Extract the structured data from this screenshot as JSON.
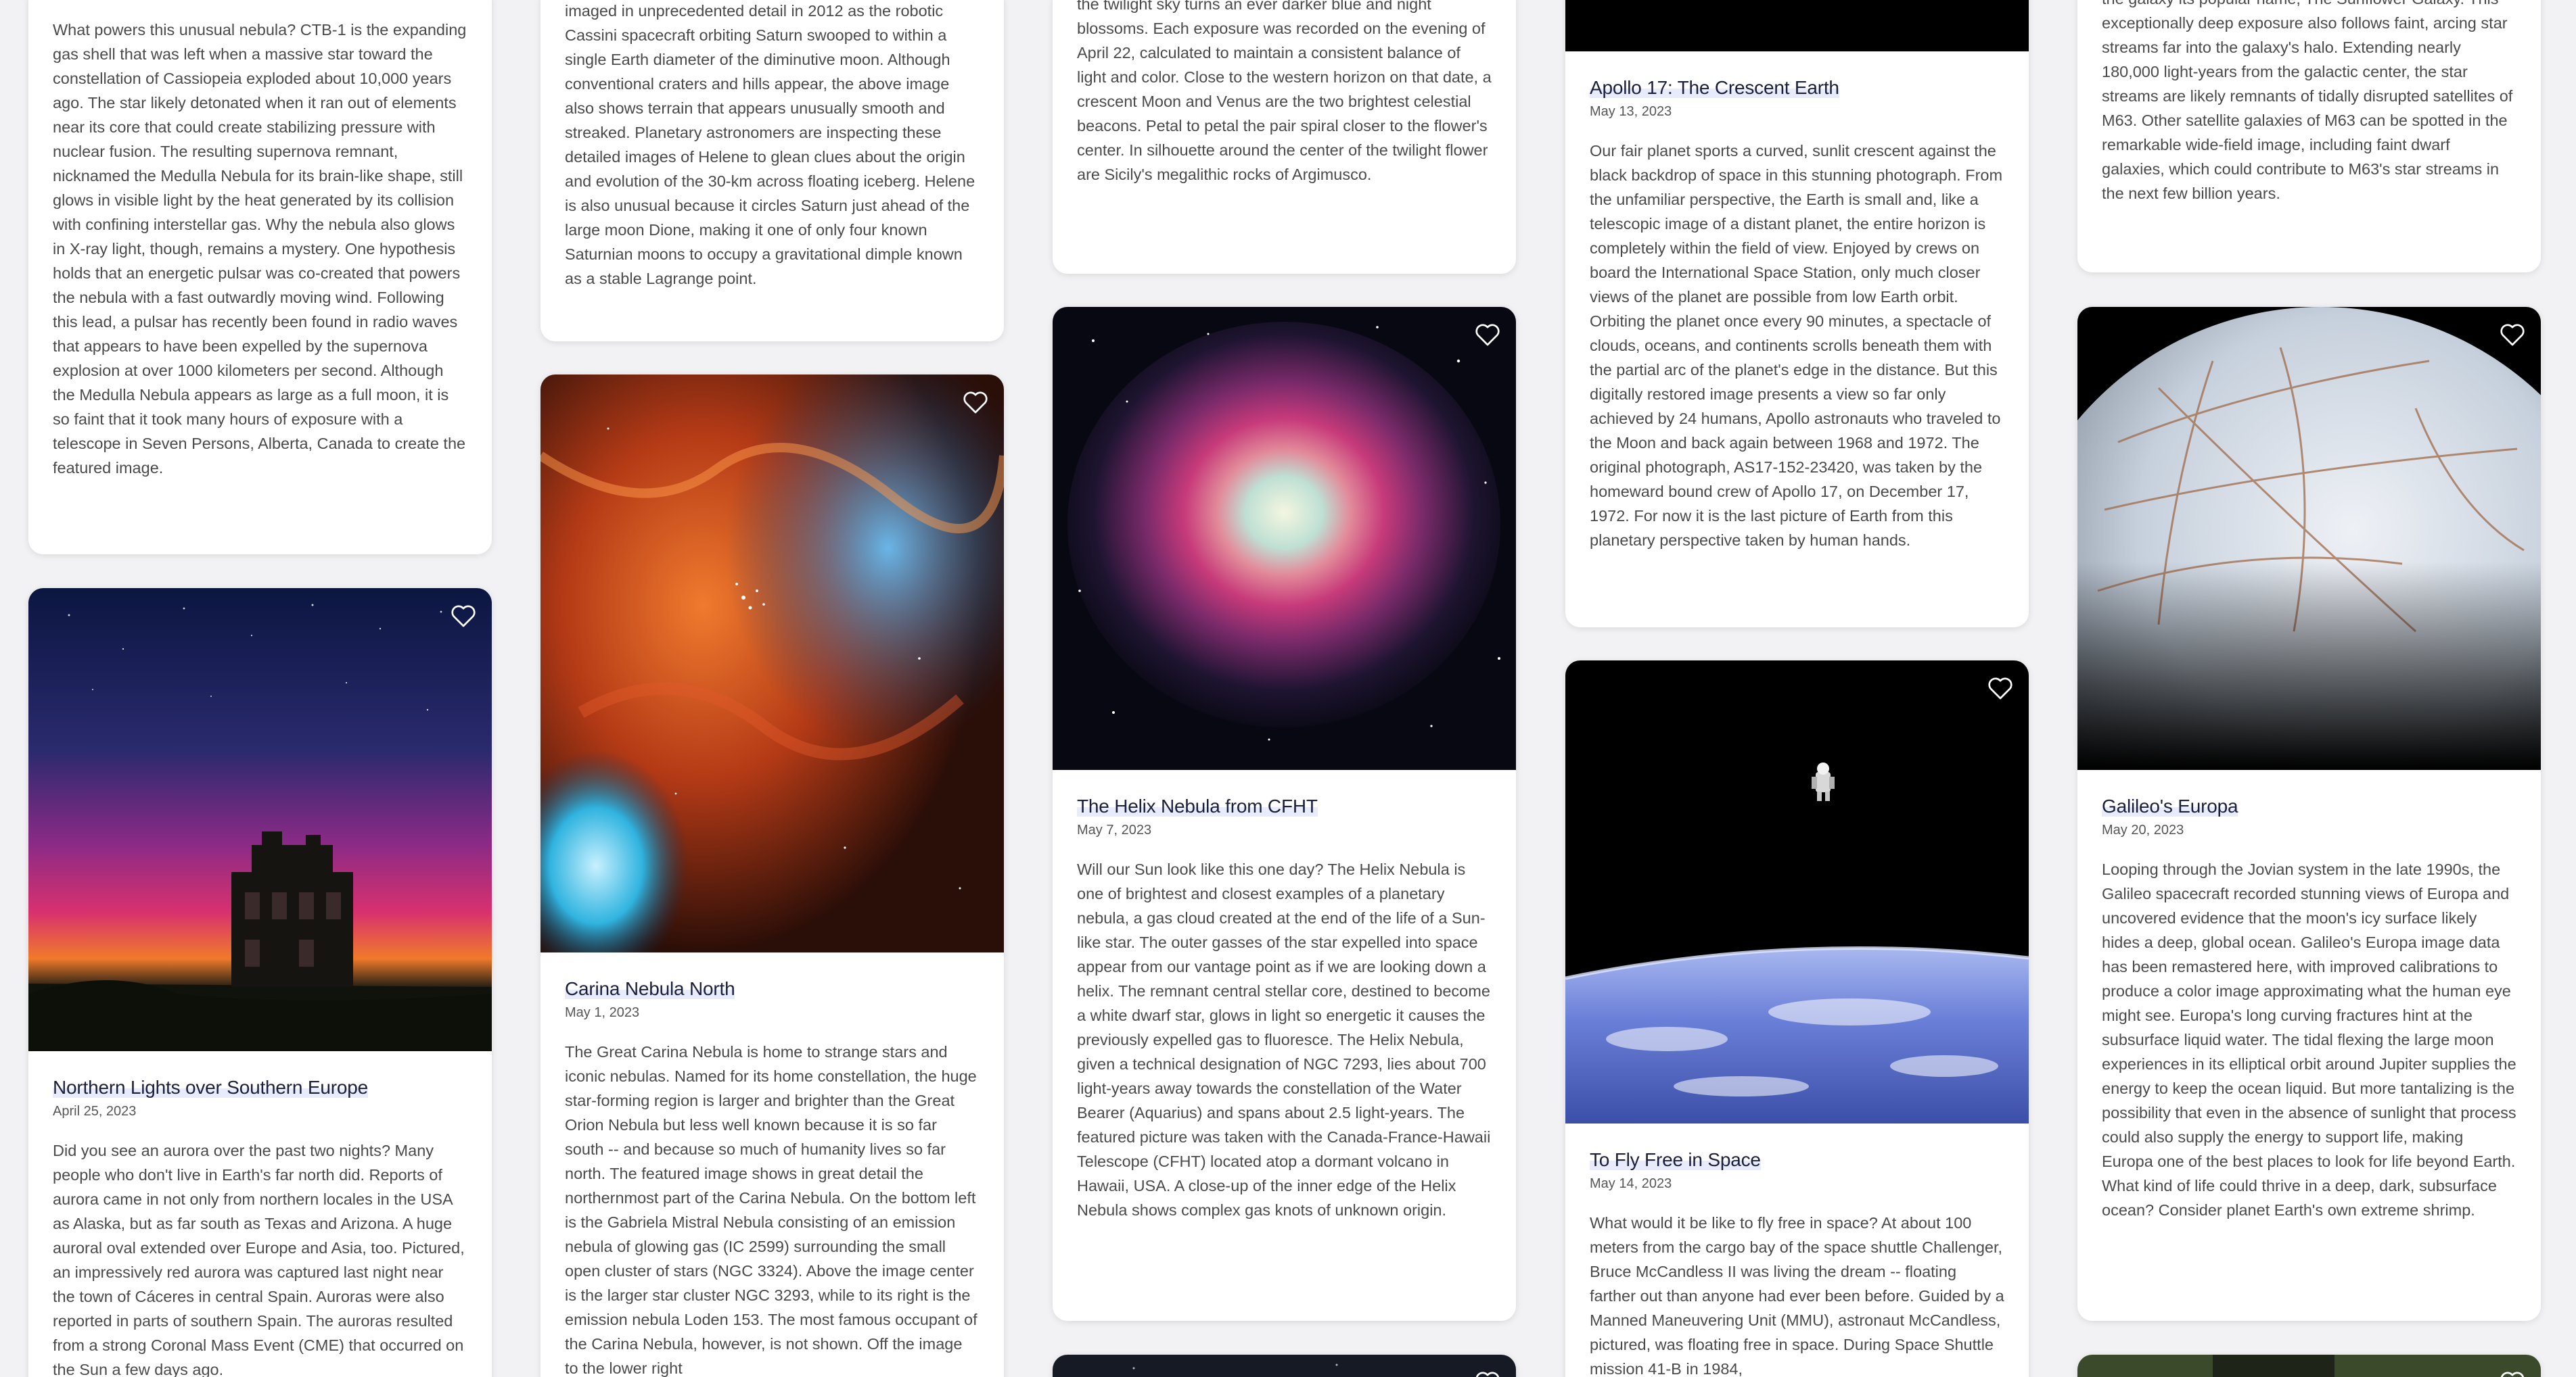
{
  "cards": {
    "ctb1": {
      "text": "What powers this unusual nebula? CTB-1 is the expanding gas shell that was left when a massive star toward the constellation of Cassiopeia exploded about 10,000 years ago. The star likely detonated when it ran out of elements near its core that could create stabilizing pressure with nuclear fusion. The resulting supernova remnant, nicknamed the Medulla Nebula for its brain-like shape, still glows in visible light by the heat generated by its collision with confining interstellar gas. Why the nebula also glows in X-ray light, though, remains a mystery. One hypothesis holds that an energetic pulsar was co-created that powers the nebula with a fast outwardly moving wind. Following this lead, a pulsar has recently been found in radio waves that appears to have been expelled by the supernova explosion at over 1000 kilometers per second. Although the Medulla Nebula appears as large as a full moon, it is so faint that it took many hours of exposure with a telescope in Seven Persons, Alberta, Canada to create the featured image."
    },
    "helene": {
      "text": "imaged in unprecedented detail in 2012 as the robotic Cassini spacecraft orbiting Saturn swooped to within a single Earth diameter of the diminutive moon. Although conventional craters and hills appear, the above image also shows terrain that appears unusually smooth and streaked. Planetary astronomers are inspecting these detailed images of Helene to glean clues about the origin and evolution of the 30-km across floating iceberg. Helene is also unusual because it circles Saturn just ahead of the large moon Dione, making it one of only four known Saturnian moons to occupy a gravitational dimple known as a stable Lagrange point."
    },
    "flower": {
      "text": "the twilight sky turns an ever darker blue and night blossoms. Each exposure was recorded on the evening of April 22, calculated to maintain a consistent balance of light and color. Close to the western horizon on that date, a crescent Moon and Venus are the two brightest celestial beacons. Petal to petal the pair spiral closer to the flower's center. In silhouette around the center of the twilight flower are Sicily's megalithic rocks of Argimusco."
    },
    "apollo": {
      "title": "Apollo 17: The Crescent Earth",
      "date": "May 13, 2023",
      "text": "Our fair planet sports a curved, sunlit crescent against the black backdrop of space in this stunning photograph. From the unfamiliar perspective, the Earth is small and, like a telescopic image of a distant planet, the entire horizon is completely within the field of view. Enjoyed by crews on board the International Space Station, only much closer views of the planet are possible from low Earth orbit. Orbiting the planet once every 90 minutes, a spectacle of clouds, oceans, and continents scrolls beneath them with the partial arc of the planet's edge in the distance. But this digitally restored image presents a view so far only achieved by 24 humans, Apollo astronauts who traveled to the Moon and back again between 1968 and 1972. The original photograph, AS17-152-23420, was taken by the homeward bound crew of Apollo 17, on December 17, 1972. For now it is the last picture of Earth from this planetary perspective taken by human hands."
    },
    "sunflower": {
      "text": "the galaxy its popular name, The Sunflower Galaxy. This exceptionally deep exposure also follows faint, arcing star streams far into the galaxy's halo. Extending nearly 180,000 light-years from the galactic center, the star streams are likely remnants of tidally disrupted satellites of M63. Other satellite galaxies of M63 can be spotted in the remarkable wide-field image, including faint dwarf galaxies, which could contribute to M63's star streams in the next few billion years."
    },
    "aurora": {
      "title": "Northern Lights over Southern Europe",
      "date": "April 25, 2023",
      "text": "Did you see an aurora over the past two nights? Many people who don't live in Earth's far north did. Reports of aurora came in not only from northern locales in the USA as Alaska, but as far south as Texas and Arizona. A huge auroral oval extended over Europe and Asia, too. Pictured, an impressively red aurora was captured last night near the town of Cáceres in central Spain. Auroras were also reported in parts of southern Spain. The auroras resulted from a strong Coronal Mass Event (CME) that occurred on the Sun a few days ago."
    },
    "carina": {
      "title": "Carina Nebula North",
      "date": "May 1, 2023",
      "text": "The Great Carina Nebula is home to strange stars and iconic nebulas. Named for its home constellation, the huge star-forming region is larger and brighter than the Great Orion Nebula but less well known because it is so far south -- and because so much of humanity lives so far north. The featured image shows in great detail the northernmost part of the Carina Nebula. On the bottom left is the Gabriela Mistral Nebula consisting of an emission nebula of glowing gas (IC 2599) surrounding the small open cluster of stars (NGC 3324). Above the image center is the larger star cluster NGC 3293, while to its right is the emission nebula Loden 153. The most famous occupant of the Carina Nebula, however, is not shown. Off the image to the lower right"
    },
    "helix": {
      "title": "The Helix Nebula from CFHT",
      "date": "May 7, 2023",
      "text": "Will our Sun look like this one day? The Helix Nebula is one of brightest and closest examples of a planetary nebula, a gas cloud created at the end of the life of a Sun-like star. The outer gasses of the star expelled into space appear from our vantage point as if we are looking down a helix. The remnant central stellar core, destined to become a white dwarf star, glows in light so energetic it causes the previously expelled gas to fluoresce. The Helix Nebula, given a technical designation of NGC 7293, lies about 700 light-years away towards the constellation of the Water Bearer (Aquarius) and spans about 2.5 light-years. The featured picture was taken with the Canada-France-Hawaii Telescope (CFHT) located atop a dormant volcano in Hawaii, USA. A close-up of the inner edge of the Helix Nebula shows complex gas knots of unknown origin."
    },
    "flyfree": {
      "title": "To Fly Free in Space",
      "date": "May 14, 2023",
      "text": "What would it be like to fly free in space? At about 100 meters from the cargo bay of the space shuttle Challenger, Bruce McCandless II was living the dream -- floating farther out than anyone had ever been before. Guided by a Manned Maneuvering Unit (MMU), astronaut McCandless, pictured, was floating free in space. During Space Shuttle mission 41-B in 1984,"
    },
    "europa": {
      "title": "Galileo's Europa",
      "date": "May 20, 2023",
      "text": "Looping through the Jovian system in the late 1990s, the Galileo spacecraft recorded stunning views of Europa and uncovered evidence that the moon's icy surface likely hides a deep, global ocean. Galileo's Europa image data has been remastered here, with improved calibrations to produce a color image approximating what the human eye might see. Europa's long curving fractures hint at the subsurface liquid water. The tidal flexing the large moon experiences in its elliptical orbit around Jupiter supplies the energy to keep the ocean liquid. But more tantalizing is the possibility that even in the absence of sunlight that process could also supply the energy to support life, making Europa one of the best places to look for life beyond Earth. What kind of life could thrive in a deep, dark, subsurface ocean? Consider planet Earth's own extreme shrimp."
    }
  },
  "icons": {
    "favorite": "heart-outline-icon"
  }
}
